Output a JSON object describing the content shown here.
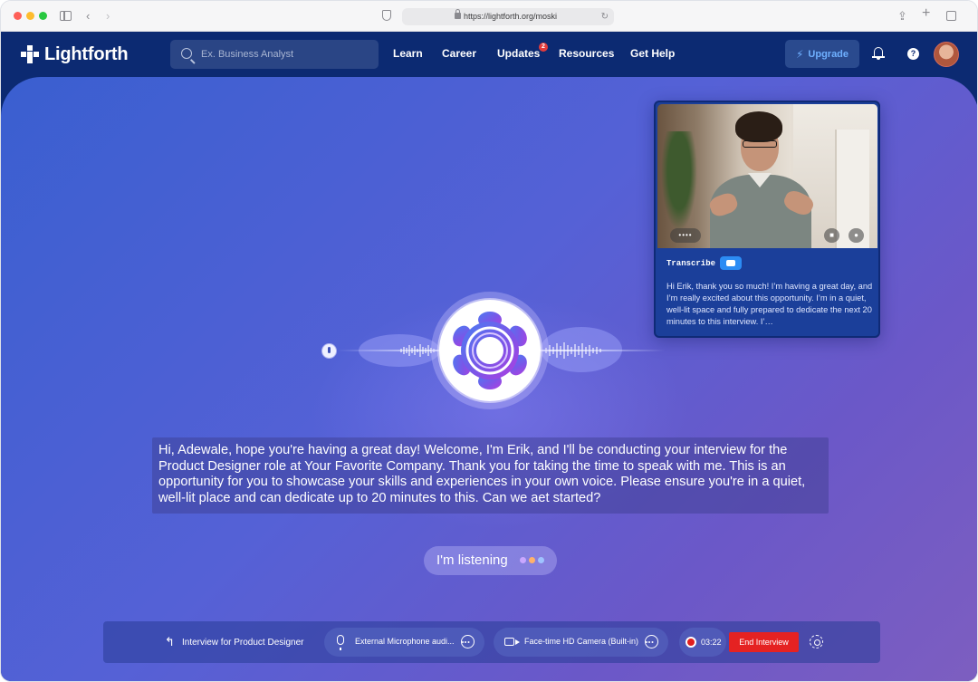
{
  "browser": {
    "url": "https://lightforth.org/moski"
  },
  "nav": {
    "logo_text": "Lightforth",
    "search_placeholder": "Ex. Business Analyst",
    "links": [
      {
        "label": "Learn"
      },
      {
        "label": "Career"
      },
      {
        "label": "Updates",
        "badge": "2"
      },
      {
        "label": "Resources"
      },
      {
        "label": "Get Help"
      }
    ],
    "upgrade_label": "Upgrade",
    "help_glyph": "?"
  },
  "video_card": {
    "transcribe_label": "Transcribe",
    "transcribe_enabled": true,
    "transcript": "Hi Erik, thank you so much! I’m having a great day, and I’m really excited about this opportunity. I’m in a quiet, well-lit space and fully prepared to dedicate the next 20 minutes to this interview. I’…"
  },
  "message": {
    "text": "Hi, Adewale, hope you're having a great day! Welcome, I'm Erik, and I'll be conducting your interview for the Product Designer role at Your Favorite Company. Thank you for taking the time to speak with me. This is an opportunity for you to showcase your skills and experiences in your own voice. Please ensure you're in a quiet, well-lit place and can dedicate up to 20 minutes to this. Can we aet started?"
  },
  "status": {
    "listening_label": "I'm listening",
    "dot_colors": [
      "#c9a7ff",
      "#ffb26b",
      "#9fc3ff"
    ]
  },
  "bottom_bar": {
    "interview_title": "Interview for Product Designer",
    "microphone_label": "External Microphone audi...",
    "camera_label": "Face-time HD Camera (Built-in)",
    "timer": "03:22",
    "end_label": "End Interview"
  },
  "colors": {
    "nav_bg": "#0c2a72",
    "accent": "#2c8cf4",
    "danger": "#e52222"
  },
  "icons": [
    "back-icon",
    "forward-icon",
    "sidebar-icon",
    "shield-icon",
    "lock-icon",
    "reload-icon",
    "share-icon",
    "plus-icon",
    "tabs-icon",
    "search-icon",
    "bolt-icon",
    "bell-icon",
    "help-icon",
    "microphone-icon",
    "camera-icon",
    "info-icon",
    "record-icon",
    "gear-icon"
  ]
}
